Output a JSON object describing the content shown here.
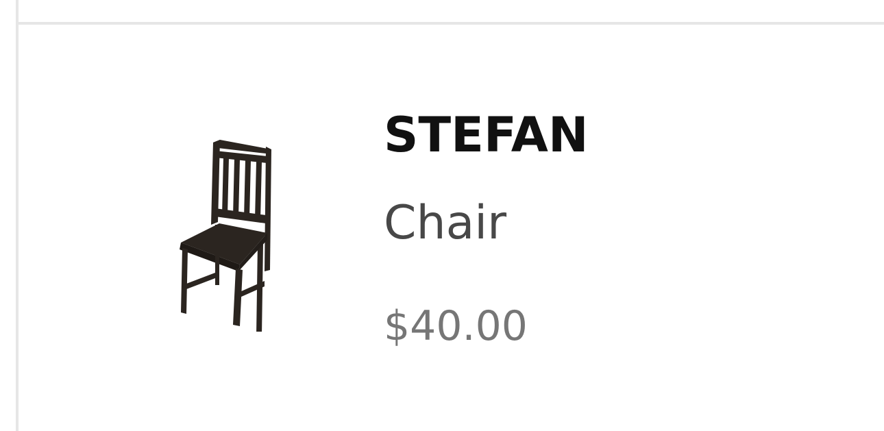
{
  "product": {
    "name": "STEFAN",
    "type": "Chair",
    "price": "$40.00",
    "image_icon": "chair-image"
  },
  "colors": {
    "name_text": "#111111",
    "type_text": "#484848",
    "price_text": "#767676",
    "border": "#e6e6e6",
    "chair_wood": "#2b2520"
  }
}
